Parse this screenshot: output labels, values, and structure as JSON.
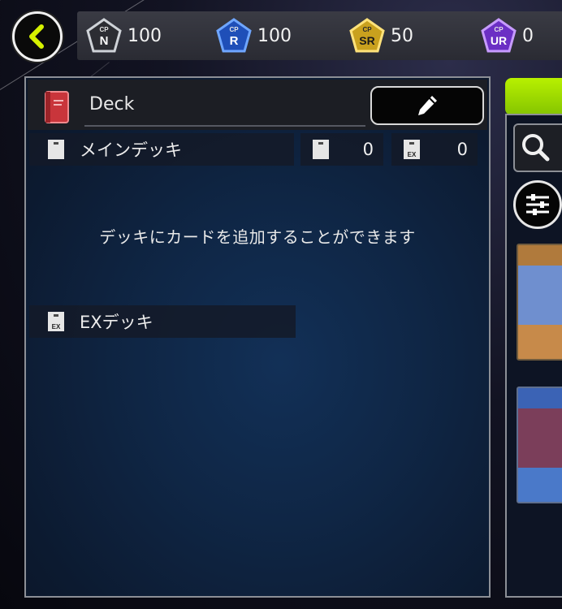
{
  "top_bar": {
    "back_icon": "chevron-left-icon",
    "cp": [
      {
        "rarity": "N",
        "label": "N",
        "value": "100",
        "color": "#9aa0a8"
      },
      {
        "rarity": "R",
        "label": "R",
        "value": "100",
        "color": "#3b7fe0"
      },
      {
        "rarity": "SR",
        "label": "SR",
        "value": "50",
        "color": "#e0b52a"
      },
      {
        "rarity": "UR",
        "label": "UR",
        "value": "0",
        "color": "#8a4fd8"
      }
    ],
    "cp_prefix": "CP"
  },
  "deck": {
    "name": "Deck",
    "edit_icon": "pencil-icon",
    "main_label": "メインデッキ",
    "main_count": "0",
    "ex_count": "0",
    "ex_glyph_label": "EX",
    "empty_message": "デッキにカードを追加することができます",
    "ex_label": "EXデッキ"
  },
  "colors": {
    "accent_green": "#a6e400",
    "deck_icon_red": "#c9353b"
  }
}
